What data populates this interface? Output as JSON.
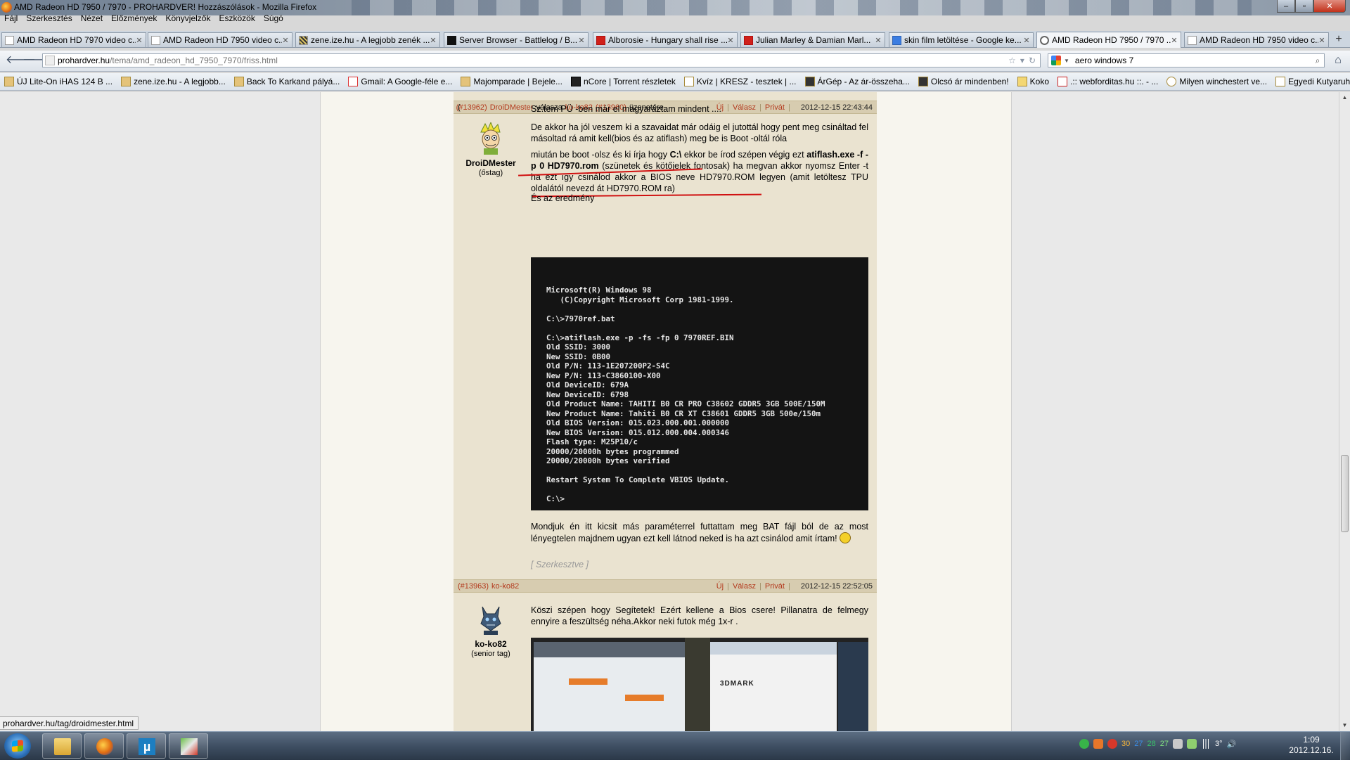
{
  "window": {
    "title": "AMD Radeon HD 7950 / 7970 - PROHARDVER! Hozzászólások - Mozilla Firefox"
  },
  "menu": [
    "Fájl",
    "Szerkesztés",
    "Nézet",
    "Előzmények",
    "Könyvjelzők",
    "Eszközök",
    "Súgó"
  ],
  "tabs": [
    {
      "label": "AMD Radeon HD 7970 video c...",
      "icon": "page-icon"
    },
    {
      "label": "AMD Radeon HD 7950 video c...",
      "icon": "page-icon"
    },
    {
      "label": "zene.ize.hu - A legjobb zenék ...",
      "icon": "zene-icon"
    },
    {
      "label": "Server Browser - Battlelog / B...",
      "icon": "battlelog-icon"
    },
    {
      "label": "Alborosie - Hungary shall rise ...",
      "icon": "youtube-icon"
    },
    {
      "label": "Julian Marley & Damian Marl...",
      "icon": "youtube-icon"
    },
    {
      "label": "skin film letöltése - Google ke...",
      "icon": "google-icon"
    },
    {
      "label": "AMD Radeon HD 7950 / 7970 ...",
      "icon": "prohardver-icon",
      "active": true
    },
    {
      "label": "AMD Radeon HD 7950 video c...",
      "icon": "page-icon"
    }
  ],
  "nav": {
    "url_domain": "prohardver.hu",
    "url_path": "/tema/amd_radeon_hd_7950_7970/friss.html",
    "search_value": "aero windows 7"
  },
  "bookmarks": [
    "ÚJ Lite-On iHAS 124 B ...",
    "zene.ize.hu - A legjobb...",
    "Back To Karkand pályá...",
    "Gmail: A Google-féle e...",
    "Majomparade | Bejele...",
    "nCore | Torrent részletek",
    "Kvíz | KRESZ - tesztek | ...",
    "ÁrGép - Az ár-összeha...",
    "Olcsó ár mindenben!",
    "Koko",
    ".:: webforditas.hu ::. - ...",
    "Milyen winchestert ve...",
    "Egyedi Kutyaruhák!!! A..."
  ],
  "post1": {
    "id": "(#13962)",
    "author": "DroiDMester",
    "reply_word": "válasza",
    "reply_to": "ko-ko82",
    "reply_id": "(#13960)",
    "reply_suffix": "üzenetére",
    "actions": [
      "Új",
      "Válasz",
      "Privát"
    ],
    "date": "2012-12-15 22:43:44",
    "user_name": "DroiDMester",
    "user_rank": "(őstag)",
    "p1": "Sz.tem PÜ -ben már el magyaráztam mindent ....",
    "p2": "De akkor ha jól veszem ki a szavaidat már odáig el jutottál hogy pent meg csináltad fel másoltad rá amit kell(bios és az atiflash) meg be is Boot -oltál róla",
    "p3_a": "miután be boot -olsz és ki írja hogy ",
    "p3_b": "C:\\",
    "p3_c": " ekkor be írod szépen végig ezt ",
    "p3_cmd": "atiflash.exe -f -p 0 HD7970.rom",
    "p3_d": " (szünetek és kötőjelek fontosak) ha megvan akkor nyomsz Enter -t ha ezt így csinálod akkor a BIOS neve HD7970.ROM legyen (amit letöltesz TPU oldalától nevezd át HD7970.ROM ra)",
    "p4": "És az eredmény",
    "console": "Microsoft(R) Windows 98\n   (C)Copyright Microsoft Corp 1981-1999.\n\nC:\\>7970ref.bat\n\nC:\\>atiflash.exe -p -fs -fp 0 7970REF.BIN\nOld SSID: 3000\nNew SSID: 0B00\nOld P/N: 113-1E207200P2-S4C\nNew P/N: 113-C3860100-X00\nOld DeviceID: 679A\nNew DeviceID: 6798\nOld Product Name: TAHITI B0 CR PRO C38602 GDDR5 3GB 500E/150M\nNew Product Name: Tahiti B0 CR XT C38601 GDDR5 3GB 500e/150m\nOld BIOS Version: 015.023.000.001.000000\nNew BIOS Version: 015.012.000.004.000346\nFlash type: M25P10/c\n20000/20000h bytes programmed\n20000/20000h bytes verified\n\nRestart System To Complete VBIOS Update.\n\nC:\\>",
    "p5": "Mondjuk én itt kicsit más paraméterrel futtattam meg BAT fájl ból de az most lényegtelen majdnem ugyan ezt kell látnod neked is ha azt csinálod amit írtam!",
    "edited": "[ Szerkesztve ]"
  },
  "post2": {
    "id": "(#13963)",
    "author": "ko-ko82",
    "actions": [
      "Új",
      "Válasz",
      "Privát"
    ],
    "date": "2012-12-15 22:52:05",
    "user_name": "ko-ko82",
    "user_rank": "(senior tag)",
    "p1": "Köszi szépen hogy Segítetek! Ezért kellene a Bios csere! Pillanatra de felmegy ennyire a feszültség néha.Akkor neki futok még 1x-r .",
    "shot_logo": "3DMARK"
  },
  "status": {
    "text": "prohardver.hu/tag/droidmester.html"
  },
  "taskbar": {
    "tray_numbers": [
      "30",
      "27",
      "28",
      "27"
    ],
    "tray_temp": "3°",
    "clock_time": "1:09",
    "clock_date": "2012.12.16."
  },
  "colors": {
    "accent_red": "#b33a1e",
    "post_bg": "#eae3d0",
    "header_bg": "#d7ccb0"
  }
}
